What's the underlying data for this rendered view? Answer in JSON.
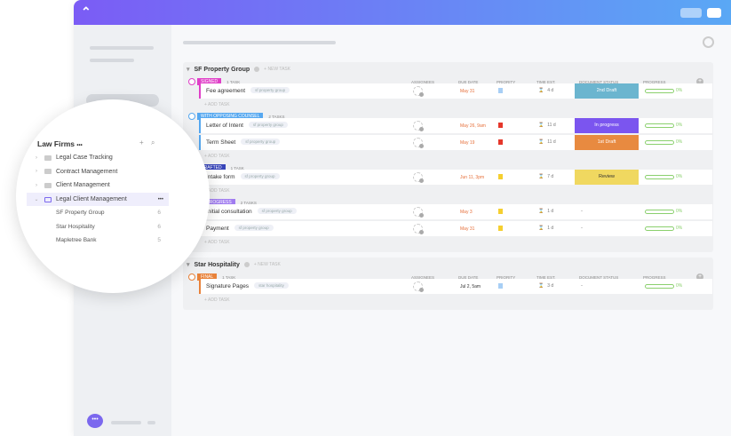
{
  "sidebar": {
    "workspace": "Law Firms",
    "more": "•••",
    "add": "+",
    "search": "⌕",
    "items": [
      {
        "label": "Legal Case Tracking"
      },
      {
        "label": "Contract Management"
      },
      {
        "label": "Client Management"
      },
      {
        "label": "Legal Client Management",
        "selected": true,
        "more": "•••"
      }
    ],
    "lists": [
      {
        "label": "SF Property Group",
        "count": "6"
      },
      {
        "label": "Star Hospitality",
        "count": "6"
      },
      {
        "label": "Mapletree Bank",
        "count": "5"
      }
    ]
  },
  "columns": [
    "Assignees",
    "Due date",
    "Priority",
    "Time est.",
    "Document status",
    "Progress"
  ],
  "new_task": "+ NEW TASK",
  "add_task": "+ ADD TASK",
  "groups": [
    {
      "title": "SF Property Group",
      "statuses": [
        {
          "label": "SIGNED",
          "count": "1 TASK",
          "color": "#e040c8",
          "tasks": [
            {
              "name": "Fee agreement",
              "tag": "sf property group",
              "due": "May 31",
              "priority": "#a8cff5",
              "time": "4 d",
              "doc": "2nd Draft",
              "doc_bg": "#6bb5cf",
              "doc_fg": "#fff",
              "progress": 0,
              "pct": "0%"
            }
          ]
        },
        {
          "label": "WITH OPPOSING COUNSEL",
          "count": "2 TASKS",
          "color": "#56a8f0",
          "tasks": [
            {
              "name": "Letter of Intent",
              "tag": "sf property group",
              "due": "May 26, 9am",
              "priority": "#e5372b",
              "time": "11 d",
              "doc": "In progress",
              "doc_bg": "#7b55ef",
              "doc_fg": "#fff",
              "progress": 0,
              "pct": "0%"
            },
            {
              "name": "Term Sheet",
              "tag": "sf property group",
              "due": "May 19",
              "priority": "#e5372b",
              "time": "11 d",
              "doc": "1st Draft",
              "doc_bg": "#e88a40",
              "doc_fg": "#fff",
              "progress": 0,
              "pct": "0%"
            }
          ]
        },
        {
          "label": "DRAFTED",
          "count": "1 TASK",
          "color": "#3744b8",
          "tasks": [
            {
              "name": "Intake form",
              "tag": "sf property group",
              "due": "Jun 11, 3pm",
              "priority": "#f5cf30",
              "time": "7 d",
              "doc": "Review",
              "doc_bg": "#f0d860",
              "doc_fg": "#333",
              "progress": 0,
              "pct": "0%"
            }
          ]
        },
        {
          "label": "IN PROGRESS",
          "count": "2 TASKS",
          "color": "#a07cf0",
          "tasks": [
            {
              "name": "Initial consultation",
              "tag": "sf property group",
              "due": "May 3",
              "priority": "#f5cf30",
              "time": "1 d",
              "doc": "-",
              "progress": 0,
              "pct": "0%"
            },
            {
              "name": "Payment",
              "tag": "sf property group",
              "due": "May 31",
              "priority": "#f5cf30",
              "time": "1 d",
              "doc": "-",
              "progress": 0,
              "pct": "0%"
            }
          ]
        }
      ]
    },
    {
      "title": "Star Hospitality",
      "statuses": [
        {
          "label": "FINAL",
          "count": "1 TASK",
          "color": "#e8823a",
          "tasks": [
            {
              "name": "Signature Pages",
              "tag": "star hospitality",
              "due": "Jul 2, 5am",
              "due_color": "#333",
              "priority": "#a8cff5",
              "time": "3 d",
              "doc": "-",
              "progress": 0,
              "pct": "0%"
            }
          ]
        }
      ]
    }
  ]
}
